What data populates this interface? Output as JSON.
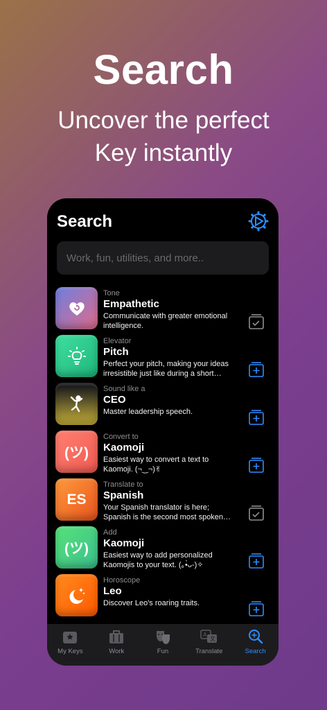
{
  "promo": {
    "title": "Search",
    "subtitle_line1": "Uncover the perfect",
    "subtitle_line2": "Key instantly"
  },
  "screen": {
    "title": "Search",
    "search_placeholder": "Work, fun, utilities, and more.."
  },
  "items": [
    {
      "category": "Tone",
      "name": "Empathetic",
      "description": "Communicate with greater emotional intelligence.",
      "icon": "heart-icon",
      "tile_text": "",
      "action": "added"
    },
    {
      "category": "Elevator",
      "name": "Pitch",
      "description": "Perfect your pitch, making your ideas irresistible just like during a short elevator ride.",
      "icon": "lightbulb-icon",
      "tile_text": "",
      "action": "add"
    },
    {
      "category": "Sound like a",
      "name": "CEO",
      "description": "Master leadership speech.",
      "icon": "ceo-figure-icon",
      "tile_text": "",
      "action": "add"
    },
    {
      "category": "Convert to",
      "name": "Kaomoji",
      "description": "Easiest way to convert a text to Kaomoji. (¬‿¬)✌",
      "icon": "kaomoji-icon",
      "tile_text": "(ツ)",
      "action": "add"
    },
    {
      "category": "Translate to",
      "name": "Spanish",
      "description": "Your Spanish translator is here; Spanish is the second most spoken language.",
      "icon": "es-text-icon",
      "tile_text": "ES",
      "action": "added"
    },
    {
      "category": "Add",
      "name": "Kaomoji",
      "description": "Easiest way to add personalized Kaomojis to your text. (｡•̀ᴗ-)✧",
      "icon": "kaomoji-icon",
      "tile_text": "(ツ)",
      "action": "add"
    },
    {
      "category": "Horoscope",
      "name": "Leo",
      "description": "Discover Leo's roaring traits.",
      "icon": "moon-stars-icon",
      "tile_text": "",
      "action": "add"
    }
  ],
  "tabs": [
    {
      "label": "My Keys",
      "icon": "keys-icon",
      "active": false
    },
    {
      "label": "Work",
      "icon": "briefcase-icon",
      "active": false
    },
    {
      "label": "Fun",
      "icon": "theater-masks-icon",
      "active": false
    },
    {
      "label": "Translate",
      "icon": "translate-icon",
      "active": false
    },
    {
      "label": "Search",
      "icon": "search-icon",
      "active": true
    }
  ],
  "colors": {
    "accent": "#2f8dff",
    "tile_gradients": [
      [
        "#6d7fe0",
        "#e06b8a"
      ],
      [
        "#3fdfa0",
        "#1fb67a"
      ],
      [
        "#1e1e1e",
        "#c8b23a"
      ],
      [
        "#ff8070",
        "#f05a52"
      ],
      [
        "#ff9a3c",
        "#e8541e"
      ],
      [
        "#56e27a",
        "#3bbf8d"
      ],
      [
        "#ff8a1e",
        "#ff5a00"
      ]
    ]
  }
}
